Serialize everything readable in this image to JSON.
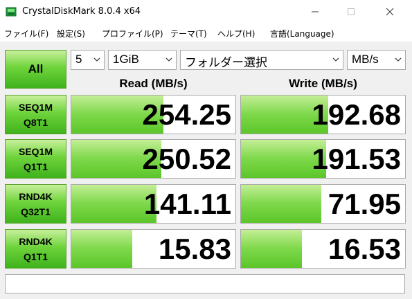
{
  "window": {
    "title": "CrystalDiskMark 8.0.4 x64"
  },
  "menu": {
    "items": [
      "ファイル(F)",
      "設定(S)",
      "プロファイル(P)",
      "テーマ(T)",
      "ヘルプ(H)",
      "言語(Language)"
    ]
  },
  "controls": {
    "all_label": "All",
    "count": "5",
    "size": "1GiB",
    "folder": "フォルダー選択",
    "unit": "MB/s"
  },
  "columns": {
    "read": "Read (MB/s)",
    "write": "Write (MB/s)"
  },
  "tests": [
    {
      "line1": "SEQ1M",
      "line2": "Q8T1",
      "read": "254.25",
      "write": "192.68",
      "read_fill": 0.56,
      "write_fill": 0.53
    },
    {
      "line1": "SEQ1M",
      "line2": "Q1T1",
      "read": "250.52",
      "write": "191.53",
      "read_fill": 0.55,
      "write_fill": 0.52
    },
    {
      "line1": "RND4K",
      "line2": "Q32T1",
      "read": "141.11",
      "write": "71.95",
      "read_fill": 0.52,
      "write_fill": 0.49
    },
    {
      "line1": "RND4K",
      "line2": "Q1T1",
      "read": "15.83",
      "write": "16.53",
      "read_fill": 0.37,
      "write_fill": 0.37
    }
  ],
  "status": "",
  "colors": {
    "accent_green": "#6fd43c",
    "bar_green": "#7dd84a"
  },
  "icons": {
    "app": "disk-icon",
    "minimize": "minimize-icon",
    "maximize": "maximize-icon",
    "close": "close-icon",
    "dropdown": "chevron-down-icon"
  }
}
